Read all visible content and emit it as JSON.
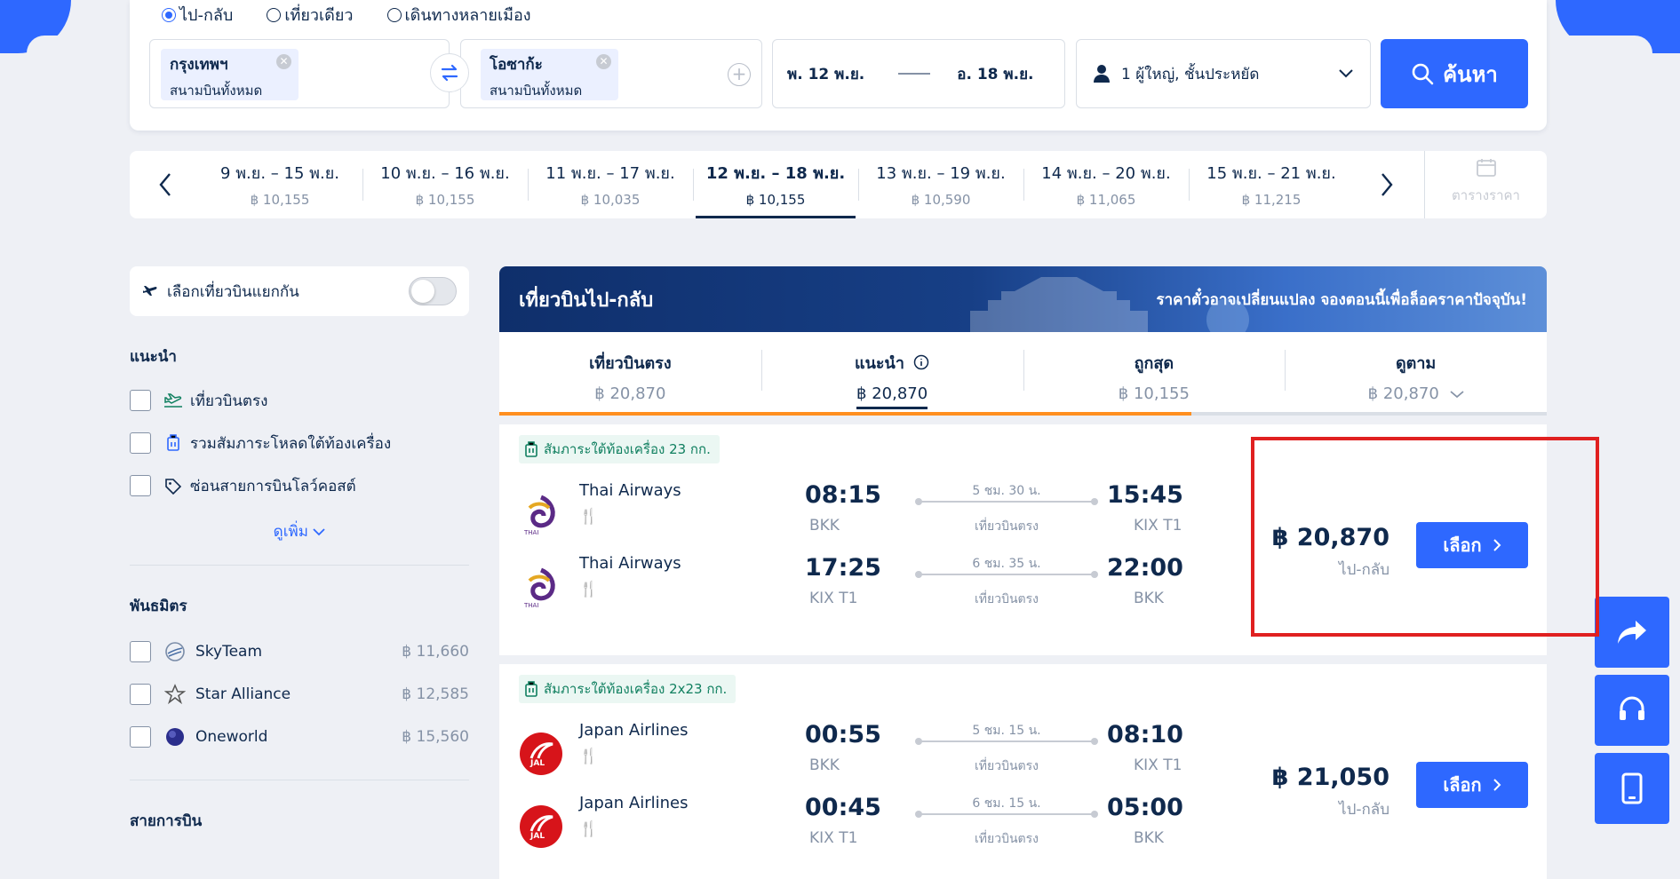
{
  "search": {
    "trip_types": [
      {
        "label": "ไป-กลับ",
        "selected": true
      },
      {
        "label": "เที่ยวเดียว",
        "selected": false
      },
      {
        "label": "เดินทางหลายเมือง",
        "selected": false
      }
    ],
    "origin": {
      "city": "กรุงเทพฯ",
      "airport": "สนามบินทั้งหมด"
    },
    "destination": {
      "city": "โอซาก้ะ",
      "airport": "สนามบินทั้งหมด"
    },
    "depart_date": "พ. 12 พ.ย.",
    "return_date": "อ. 18 พ.ย.",
    "passengers": "1 ผู้ใหญ่, ชั้นประหยัด",
    "search_label": "ค้นหา"
  },
  "date_strip": {
    "items": [
      {
        "dates": "9 พ.ย. – 15 พ.ย.",
        "price": "฿ 10,155",
        "active": false
      },
      {
        "dates": "10 พ.ย. – 16 พ.ย.",
        "price": "฿ 10,155",
        "active": false
      },
      {
        "dates": "11 พ.ย. – 17 พ.ย.",
        "price": "฿ 10,035",
        "active": false
      },
      {
        "dates": "12 พ.ย. – 18 พ.ย.",
        "price": "฿ 10,155",
        "active": true
      },
      {
        "dates": "13 พ.ย. – 19 พ.ย.",
        "price": "฿ 10,590",
        "active": false
      },
      {
        "dates": "14 พ.ย. – 20 พ.ย.",
        "price": "฿ 11,065",
        "active": false
      },
      {
        "dates": "15 พ.ย. – 21 พ.ย.",
        "price": "฿ 11,215",
        "active": false
      }
    ],
    "calendar_label": "ตารางราคา"
  },
  "sidebar": {
    "toggle_label": "เลือกเที่ยวบินแยกกัน",
    "recommend_heading": "แนะนำ",
    "recommend_items": [
      {
        "label": "เที่ยวบินตรง",
        "icon": "flight-takeoff-icon"
      },
      {
        "label": "รวมสัมภาระโหลดใต้ท้องเครื่อง",
        "icon": "luggage-icon"
      },
      {
        "label": "ซ่อนสายการบินโลว์คอสต์",
        "icon": "tag-icon"
      }
    ],
    "more_label": "ดูเพิ่ม",
    "alliance_heading": "พันธมิตร",
    "alliances": [
      {
        "label": "SkyTeam",
        "price": "฿ 11,660"
      },
      {
        "label": "Star Alliance",
        "price": "฿ 12,585"
      },
      {
        "label": "Oneworld",
        "price": "฿ 15,560"
      }
    ],
    "airlines_heading": "สายการบิน"
  },
  "results": {
    "banner_title": "เที่ยวบินไป-กลับ",
    "banner_note": "ราคาตั๋วอาจเปลี่ยนแปลง จองตอนนี้เพื่อล็อคราคาปัจจุบัน!",
    "sort_tabs": [
      {
        "label": "เที่ยวบินตรง",
        "value": "฿ 20,870",
        "active": false
      },
      {
        "label": "แนะนำ",
        "value": "฿ 20,870",
        "active": true
      },
      {
        "label": "ถูกสุด",
        "value": "฿ 10,155",
        "active": false
      },
      {
        "label": "ดูตาม",
        "value": "฿ 20,870",
        "active": false
      }
    ],
    "flights": [
      {
        "baggage": "สัมภาระใต้ท้องเครื่อง 23 กก.",
        "legs": [
          {
            "airline": "Thai Airways",
            "dep_time": "08:15",
            "dep_airport": "BKK",
            "duration": "5 ชม. 30 น.",
            "type": "เที่ยวบินตรง",
            "arr_time": "15:45",
            "arr_airport": "KIX T1"
          },
          {
            "airline": "Thai Airways",
            "dep_time": "17:25",
            "dep_airport": "KIX T1",
            "duration": "6 ชม. 35 น.",
            "type": "เที่ยวบินตรง",
            "arr_time": "22:00",
            "arr_airport": "BKK"
          }
        ],
        "price": "฿ 20,870",
        "price_note": "ไป-กลับ",
        "select_label": "เลือก"
      },
      {
        "baggage": "สัมภาระใต้ท้องเครื่อง 2x23 กก.",
        "legs": [
          {
            "airline": "Japan Airlines",
            "dep_time": "00:55",
            "dep_airport": "BKK",
            "duration": "5 ชม. 15 น.",
            "type": "เที่ยวบินตรง",
            "arr_time": "08:10",
            "arr_airport": "KIX T1"
          },
          {
            "airline": "Japan Airlines",
            "dep_time": "00:45",
            "dep_airport": "KIX T1",
            "duration": "6 ชม. 15 น.",
            "type": "เที่ยวบินตรง",
            "arr_time": "05:00",
            "arr_airport": "BKK"
          }
        ],
        "price": "฿ 21,050",
        "price_note": "ไป-กลับ",
        "select_label": "เลือก"
      }
    ]
  },
  "colors": {
    "primary": "#2e68ff",
    "text": "#0f294d",
    "muted": "#8592a6",
    "accent_orange": "#ff8f1f",
    "highlight": "#e02020"
  }
}
